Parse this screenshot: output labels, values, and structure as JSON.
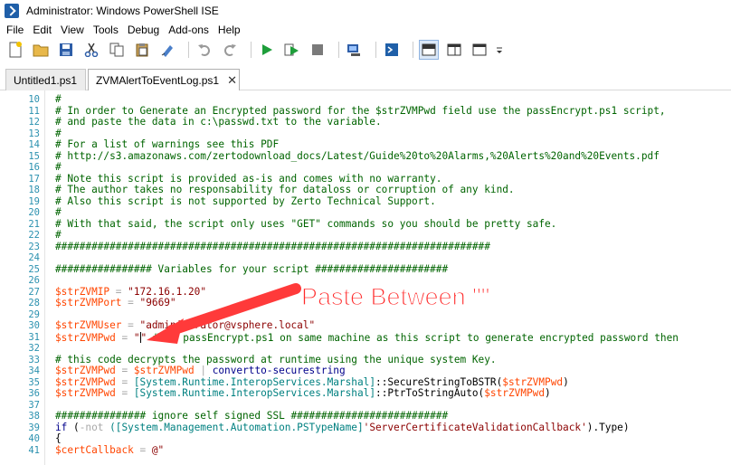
{
  "window": {
    "title": "Administrator: Windows PowerShell ISE"
  },
  "menu": [
    "File",
    "Edit",
    "View",
    "Tools",
    "Debug",
    "Add-ons",
    "Help"
  ],
  "tabs": [
    {
      "label": "Untitled1.ps1"
    },
    {
      "label": "ZVMAlertToEventLog.ps1",
      "close": "✕"
    }
  ],
  "annotation": {
    "text": "Paste Between \"\"",
    "color": "#ff2a2a"
  },
  "editor": {
    "line_numbers": [
      "10",
      "11",
      "12",
      "13",
      "14",
      "15",
      "16",
      "17",
      "18",
      "19",
      "20",
      "21",
      "22",
      "23",
      "24",
      "25",
      "26",
      "27",
      "28",
      "29",
      "30",
      "31",
      "32",
      "33",
      "34",
      "35",
      "36",
      "37",
      "38",
      "39",
      "40",
      "41"
    ],
    "lines": [
      {
        "tokens": [
          {
            "t": "#",
            "c": "c"
          }
        ]
      },
      {
        "tokens": [
          {
            "t": "# In order to Generate an Encrypted password for the $strZVMPwd field use the passEncrypt.ps1 script,",
            "c": "c"
          }
        ]
      },
      {
        "tokens": [
          {
            "t": "# and paste the data in c:\\passwd.txt to the variable.",
            "c": "c"
          }
        ]
      },
      {
        "tokens": [
          {
            "t": "#",
            "c": "c"
          }
        ]
      },
      {
        "tokens": [
          {
            "t": "# For a list of warnings see this PDF",
            "c": "c"
          }
        ]
      },
      {
        "tokens": [
          {
            "t": "# http://s3.amazonaws.com/zertodownload_docs/Latest/Guide%20to%20Alarms,%20Alerts%20and%20Events.pdf",
            "c": "c"
          }
        ]
      },
      {
        "tokens": [
          {
            "t": "#",
            "c": "c"
          }
        ]
      },
      {
        "tokens": [
          {
            "t": "# Note this script is provided as-is and comes with no warranty.",
            "c": "c"
          }
        ]
      },
      {
        "tokens": [
          {
            "t": "# The author takes no responsability for dataloss or corruption of any kind.",
            "c": "c"
          }
        ]
      },
      {
        "tokens": [
          {
            "t": "# Also this script is not supported by Zerto Technical Support.",
            "c": "c"
          }
        ]
      },
      {
        "tokens": [
          {
            "t": "#",
            "c": "c"
          }
        ]
      },
      {
        "tokens": [
          {
            "t": "# With that said, the script only uses \"GET\" commands so you should be pretty safe.",
            "c": "c"
          }
        ]
      },
      {
        "tokens": [
          {
            "t": "#",
            "c": "c"
          }
        ]
      },
      {
        "tokens": [
          {
            "t": "########################################################################",
            "c": "c"
          }
        ]
      },
      {
        "tokens": []
      },
      {
        "tokens": [
          {
            "t": "################ Variables for your script ######################",
            "c": "c"
          }
        ]
      },
      {
        "tokens": []
      },
      {
        "tokens": [
          {
            "t": "$strZVMIP",
            "c": "v"
          },
          {
            "t": " = ",
            "c": "o"
          },
          {
            "t": "\"172.16.1.20\"",
            "c": "s"
          }
        ]
      },
      {
        "tokens": [
          {
            "t": "$strZVMPort",
            "c": "v"
          },
          {
            "t": " = ",
            "c": "o"
          },
          {
            "t": "\"9669\"",
            "c": "s"
          }
        ]
      },
      {
        "tokens": []
      },
      {
        "tokens": [
          {
            "t": "$strZVMUser",
            "c": "v"
          },
          {
            "t": " = ",
            "c": "o"
          },
          {
            "t": "\"administrator@vsphere.local\"",
            "c": "s"
          }
        ]
      },
      {
        "tokens": [
          {
            "t": "$strZVMPwd",
            "c": "v"
          },
          {
            "t": " = ",
            "c": "o"
          },
          {
            "t": "\"",
            "c": "s"
          },
          {
            "t": "CARET",
            "c": "caret"
          },
          {
            "t": "\"",
            "c": "s"
          },
          {
            "t": " #run passEncrypt.ps1 on same machine as this script to generate encrypted password then",
            "c": "c"
          }
        ]
      },
      {
        "tokens": []
      },
      {
        "tokens": [
          {
            "t": "# this code decrypts the password at runtime using the unique system Key.",
            "c": "c"
          }
        ]
      },
      {
        "tokens": [
          {
            "t": "$strZVMPwd",
            "c": "v"
          },
          {
            "t": " = ",
            "c": "o"
          },
          {
            "t": "$strZVMPwd",
            "c": "v"
          },
          {
            "t": " | ",
            "c": "o"
          },
          {
            "t": "convertto-securestring",
            "c": "k"
          }
        ]
      },
      {
        "tokens": [
          {
            "t": "$strZVMPwd",
            "c": "v"
          },
          {
            "t": " = ",
            "c": "o"
          },
          {
            "t": "[System.Runtime.InteropServices.Marshal]",
            "c": "t"
          },
          {
            "t": "::SecureStringToBSTR(",
            "c": "m"
          },
          {
            "t": "$strZVMPwd",
            "c": "v"
          },
          {
            "t": ")",
            "c": "m"
          }
        ]
      },
      {
        "tokens": [
          {
            "t": "$strZVMPwd",
            "c": "v"
          },
          {
            "t": " = ",
            "c": "o"
          },
          {
            "t": "[System.Runtime.InteropServices.Marshal]",
            "c": "t"
          },
          {
            "t": "::PtrToStringAuto(",
            "c": "m"
          },
          {
            "t": "$strZVMPwd",
            "c": "v"
          },
          {
            "t": ")",
            "c": "m"
          }
        ]
      },
      {
        "tokens": []
      },
      {
        "tokens": [
          {
            "t": "############### ignore self signed SSL ##########################",
            "c": "c"
          }
        ]
      },
      {
        "tokens": [
          {
            "t": "if",
            "c": "k"
          },
          {
            "t": " (",
            "c": "m"
          },
          {
            "t": "-not",
            "c": "o"
          },
          {
            "t": " ([System.Management.Automation.PSTypeName]",
            "c": "t"
          },
          {
            "t": "'ServerCertificateValidationCallback'",
            "c": "s"
          },
          {
            "t": ").Type)",
            "c": "m"
          }
        ]
      },
      {
        "tokens": [
          {
            "t": "{",
            "c": "m"
          }
        ]
      },
      {
        "tokens": [
          {
            "t": "$certCallback",
            "c": "v"
          },
          {
            "t": " = ",
            "c": "o"
          },
          {
            "t": "@\"",
            "c": "s"
          }
        ]
      }
    ]
  },
  "toolbar": {
    "icons": [
      "new-file-icon",
      "open-icon",
      "save-icon",
      "cut-icon",
      "copy-icon",
      "paste-icon",
      "clear-console-icon",
      "undo-icon",
      "redo-icon",
      "run-icon",
      "run-selection-icon",
      "stop-icon",
      "remote-powershell-icon",
      "powershell-console-icon",
      "show-script-top-icon",
      "show-script-right-icon",
      "show-script-maximized-icon",
      "overflow-icon"
    ]
  }
}
